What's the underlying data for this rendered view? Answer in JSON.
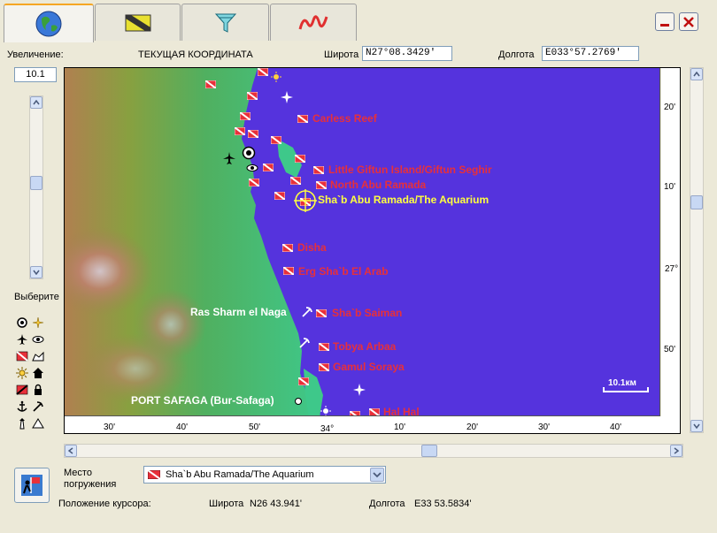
{
  "window": {
    "tabs": [
      {
        "name": "globe-icon"
      },
      {
        "name": "dive-flag-icon"
      },
      {
        "name": "filter-icon"
      },
      {
        "name": "profile-wave-icon"
      }
    ]
  },
  "header": {
    "zoom_label": "Увеличение:",
    "zoom_value": "10.1",
    "current_coord_label": "ТЕКУЩАЯ КООРДИНАТА",
    "lat_label": "Широта",
    "lat_value": "N27°08.3429'",
    "lon_label": "Долгота",
    "lon_value": "E033°57.2769'"
  },
  "sidebar": {
    "select_label": "Выберите"
  },
  "map": {
    "sites": [
      {
        "label": "Carless Reef",
        "color": "#e8303a"
      },
      {
        "label": "Little Giftun Island/Giftun Seghir",
        "color": "#e8303a"
      },
      {
        "label": "North Abu Ramada",
        "color": "#e8303a"
      },
      {
        "label": "Sha`b Abu Ramada/The Aquarium",
        "color": "#ffff40"
      },
      {
        "label": "Disha",
        "color": "#e8303a"
      },
      {
        "label": "Erg Sha`b El Arab",
        "color": "#e8303a"
      },
      {
        "label": "Sha`b Saiman",
        "color": "#e8303a"
      },
      {
        "label": "Tobya Arbaa",
        "color": "#e8303a"
      },
      {
        "label": "Gamul Soraya",
        "color": "#e8303a"
      },
      {
        "label": "Hal Hal",
        "color": "#e8303a"
      }
    ],
    "places": [
      {
        "label": "Ras Sharm el Naga"
      },
      {
        "label": "PORT SAFAGA (Bur-Safaga)"
      }
    ],
    "scale_label": "10.1км",
    "x_ticks": [
      "30'",
      "40'",
      "50'",
      "34°",
      "10'",
      "20'",
      "30'",
      "40'"
    ],
    "y_ticks": [
      "20'",
      "10'",
      "27°",
      "50'"
    ]
  },
  "footer": {
    "dive_site_label_1": "Место",
    "dive_site_label_2": "погружения",
    "dive_site_value": "Sha`b Abu Ramada/The Aquarium",
    "cursor_label": "Положение курсора:",
    "cursor_lat_label": "Широта",
    "cursor_lat_value": "N26 43.941'",
    "cursor_lon_label": "Долгота",
    "cursor_lon_value": "E33 53.5834'"
  },
  "colors": {
    "sea": "#5533dd",
    "land_coast": "#3ec88a",
    "land_inner": "#6fb050",
    "mountain": "#c08060",
    "site_red": "#e8303a",
    "selected_yellow": "#ffff40"
  }
}
